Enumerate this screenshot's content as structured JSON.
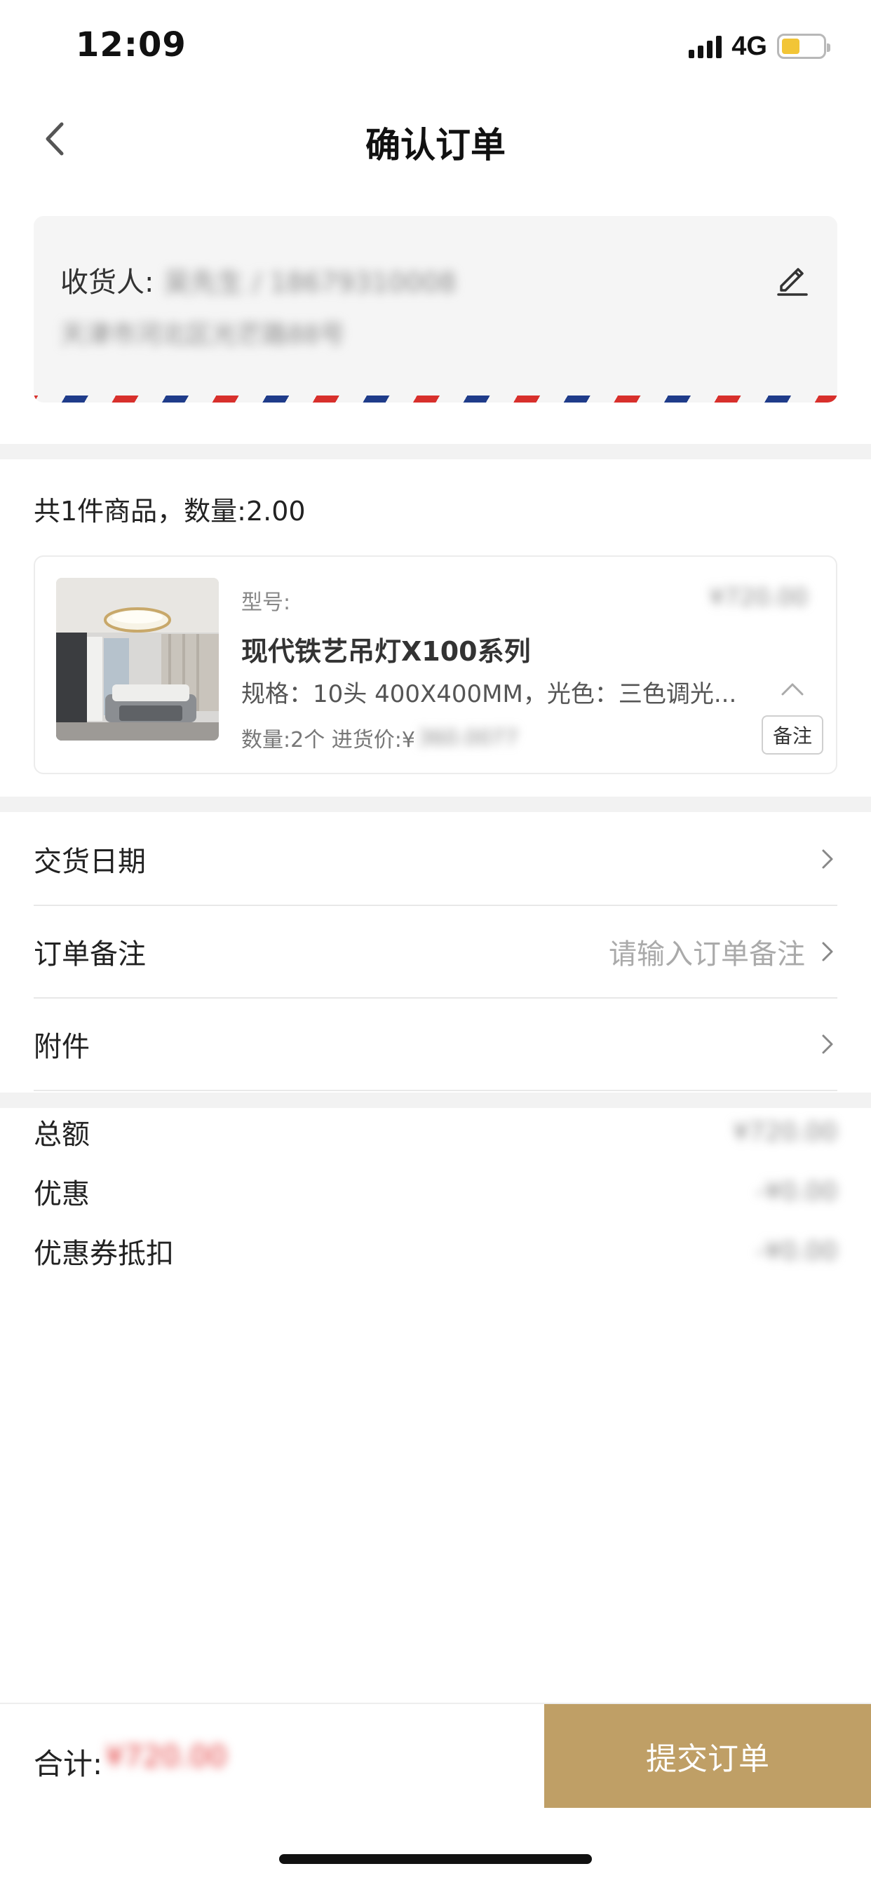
{
  "status_bar": {
    "time": "12:09",
    "network": "4G",
    "battery_level": 0.45,
    "battery_color": "#f2c536"
  },
  "nav": {
    "title": "确认订单",
    "back_icon": "chevron-left-icon"
  },
  "address": {
    "receiver_label": "收货人:",
    "receiver_contact": "吴先生 / 18679310008",
    "address_line": "天津市河北区光芒路88号",
    "edit_icon": "pencil-icon"
  },
  "items": {
    "summary": "共1件商品，数量:2.00",
    "product": {
      "model_label": "型号:",
      "price": "¥720.00",
      "name": "现代铁艺吊灯X100系列",
      "spec": "规格：10头 400X400MM，光色：三色调光...",
      "qty_label": "数量:2个 进货价:¥",
      "purchase_price": "360.0077",
      "remark_button": "备注",
      "collapse_icon": "chevron-up-icon"
    }
  },
  "rows": {
    "delivery_date": {
      "label": "交货日期"
    },
    "order_note": {
      "label": "订单备注",
      "placeholder": "请输入订单备注"
    },
    "attachment": {
      "label": "附件"
    }
  },
  "totals": {
    "total": {
      "label": "总额",
      "value": "¥720.00"
    },
    "discount": {
      "label": "优惠",
      "value": "-¥0.00"
    },
    "coupon": {
      "label": "优惠券抵扣",
      "value": "-¥0.00"
    }
  },
  "bottom_bar": {
    "sum_label": "合计:",
    "sum_value": "¥720.00",
    "submit_label": "提交订单",
    "accent_color": "#bf9f66"
  }
}
